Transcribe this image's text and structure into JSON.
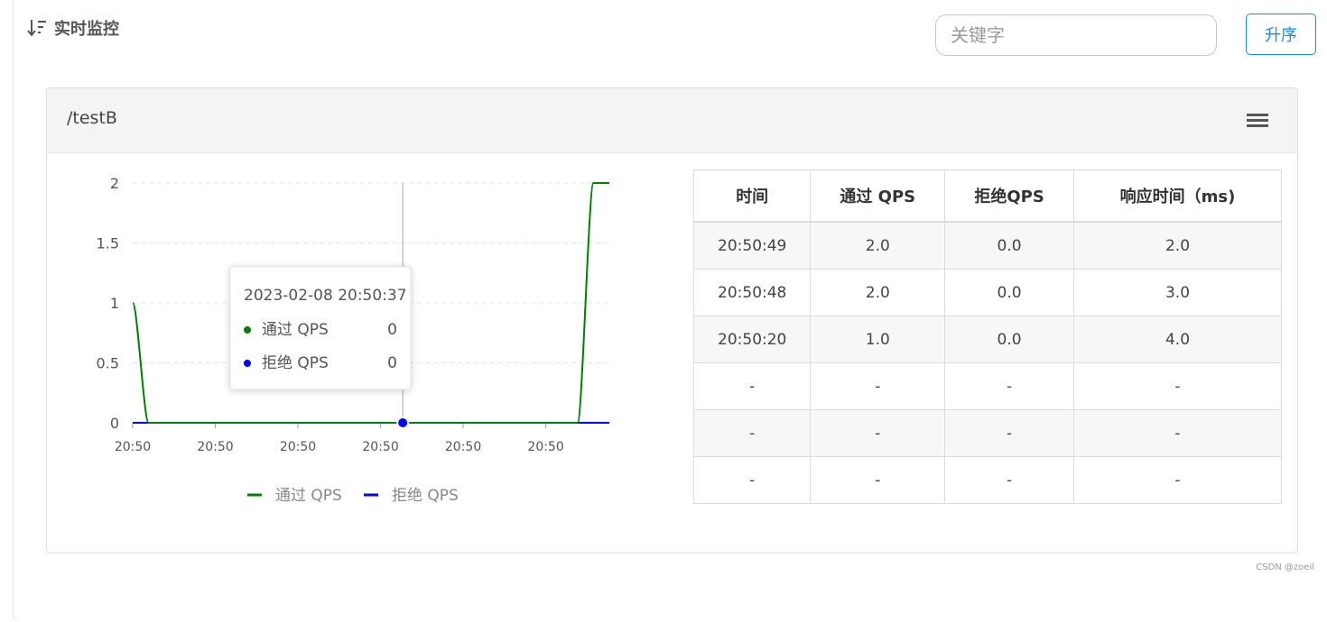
{
  "header": {
    "title": "实时监控",
    "sort_icon": "sort-descending-icon",
    "search_placeholder": "关键字",
    "search_value": "",
    "sort_button": "升序"
  },
  "panel": {
    "resource": "/testB",
    "menu_icon": "hamburger-menu-icon"
  },
  "tooltip": {
    "time": "2023-02-08 20:50:37",
    "rows": [
      {
        "label": "通过 QPS",
        "value": "0",
        "color": "#008000"
      },
      {
        "label": "拒绝 QPS",
        "value": "0",
        "color": "#0000ff"
      }
    ]
  },
  "table": {
    "headers": [
      "时间",
      "通过 QPS",
      "拒绝QPS",
      "响应时间（ms)"
    ],
    "rows": [
      [
        "20:50:49",
        "2.0",
        "0.0",
        "2.0"
      ],
      [
        "20:50:48",
        "2.0",
        "0.0",
        "3.0"
      ],
      [
        "20:50:20",
        "1.0",
        "0.0",
        "4.0"
      ],
      [
        "-",
        "-",
        "-",
        "-"
      ],
      [
        "-",
        "-",
        "-",
        "-"
      ],
      [
        "-",
        "-",
        "-",
        "-"
      ]
    ]
  },
  "chart_data": {
    "type": "line",
    "y_ticks": [
      "2",
      "1.5",
      "1",
      "0.5",
      "0"
    ],
    "x_ticks": [
      "20:50",
      "20:50",
      "20:50",
      "20:50",
      "20:50",
      "20:50"
    ],
    "ylim": [
      0,
      2
    ],
    "grid": true,
    "legend_placement": "bottom",
    "series": [
      {
        "name": "通过 QPS",
        "color": "#008000",
        "points": [
          [
            0,
            1
          ],
          [
            1,
            0
          ],
          [
            2,
            0
          ],
          [
            3,
            0
          ],
          [
            4,
            0
          ],
          [
            5,
            0
          ],
          [
            6,
            0
          ],
          [
            7,
            0
          ],
          [
            8,
            0
          ],
          [
            9,
            0
          ],
          [
            10,
            0
          ],
          [
            11,
            0
          ],
          [
            12,
            0
          ],
          [
            13,
            0
          ],
          [
            14,
            0
          ],
          [
            15,
            0
          ],
          [
            16,
            0
          ],
          [
            17,
            0
          ],
          [
            18,
            0
          ],
          [
            19,
            0
          ],
          [
            20,
            0
          ],
          [
            21,
            0
          ],
          [
            22,
            0
          ],
          [
            23,
            0
          ],
          [
            24,
            0
          ],
          [
            25,
            0
          ],
          [
            26,
            0
          ],
          [
            27,
            0
          ],
          [
            28,
            0
          ],
          [
            29,
            2
          ],
          [
            30,
            2
          ]
        ]
      },
      {
        "name": "拒绝 QPS",
        "color": "#0000ff",
        "points": [
          [
            0,
            0
          ],
          [
            1,
            0
          ],
          [
            2,
            0
          ],
          [
            3,
            0
          ],
          [
            4,
            0
          ],
          [
            5,
            0
          ],
          [
            6,
            0
          ],
          [
            7,
            0
          ],
          [
            8,
            0
          ],
          [
            9,
            0
          ],
          [
            10,
            0
          ],
          [
            11,
            0
          ],
          [
            12,
            0
          ],
          [
            13,
            0
          ],
          [
            14,
            0
          ],
          [
            15,
            0
          ],
          [
            16,
            0
          ],
          [
            17,
            0
          ],
          [
            18,
            0
          ],
          [
            19,
            0
          ],
          [
            20,
            0
          ],
          [
            21,
            0
          ],
          [
            22,
            0
          ],
          [
            23,
            0
          ],
          [
            24,
            0
          ],
          [
            25,
            0
          ],
          [
            26,
            0
          ],
          [
            27,
            0
          ],
          [
            28,
            0
          ],
          [
            29,
            0
          ],
          [
            30,
            0
          ]
        ]
      }
    ],
    "hover_index": 17,
    "hover_value": 0
  },
  "watermark": "CSDN @zoeil"
}
